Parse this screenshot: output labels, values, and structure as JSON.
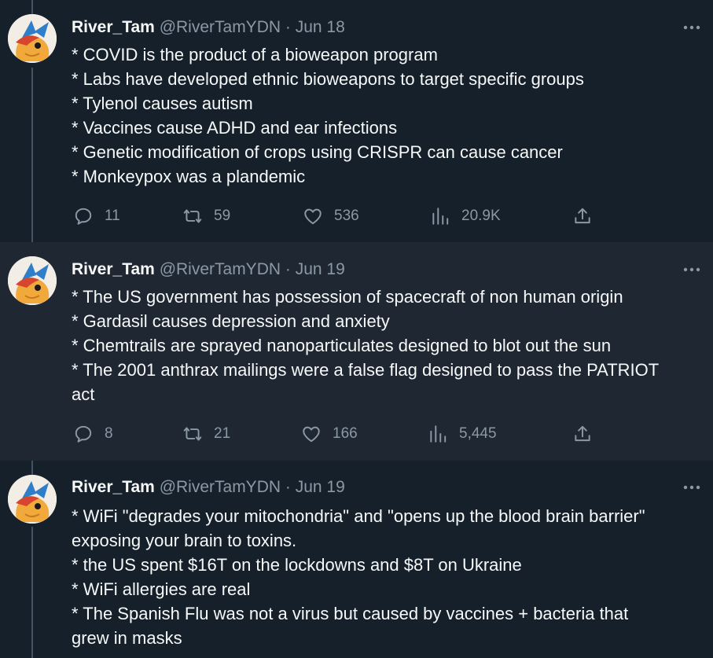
{
  "tweets": [
    {
      "name": "River_Tam",
      "handle": "@RiverTamYDN",
      "sep": " · ",
      "date": "Jun 18",
      "lines": [
        "* COVID is the product of a bioweapon program",
        "* Labs have developed ethnic bioweapons to target specific groups",
        "* Tylenol causes autism",
        "* Vaccines cause ADHD and ear infections",
        "* Genetic modification of crops using CRISPR can cause cancer",
        "* Monkeypox was a plandemic"
      ],
      "replies": "11",
      "retweets": "59",
      "likes": "536",
      "views": "20.9K"
    },
    {
      "name": "River_Tam",
      "handle": "@RiverTamYDN",
      "sep": " · ",
      "date": "Jun 19",
      "lines": [
        "* The US government has possession of spacecraft of non human origin",
        "* Gardasil causes depression and anxiety",
        "* Chemtrails are sprayed nanoparticulates designed to blot out the sun",
        "* The 2001 anthrax mailings were a false flag designed to pass the PATRIOT",
        "act"
      ],
      "replies": "8",
      "retweets": "21",
      "likes": "166",
      "views": "5,445"
    },
    {
      "name": "River_Tam",
      "handle": "@RiverTamYDN",
      "sep": " · ",
      "date": "Jun 19",
      "lines": [
        "* WiFi \"degrades your mitochondria\" and \"opens up the blood brain barrier\"",
        "exposing your brain to toxins.",
        "* the US spent $16T on the lockdowns and $8T on Ukraine",
        "* WiFi allergies are real",
        "* The Spanish Flu was not a virus but caused by vaccines + bacteria that",
        "grew in masks"
      ]
    }
  ],
  "icons": {
    "reply": "reply-icon",
    "retweet": "retweet-icon",
    "like": "heart-icon",
    "views": "views-icon",
    "share": "share-icon",
    "more": "more-icon"
  },
  "colors": {
    "background": "#15202b",
    "highlight_background": "#1e2732",
    "text": "#f7f9f9",
    "secondary_text": "#8b98a5",
    "thread_line": "#425364"
  }
}
